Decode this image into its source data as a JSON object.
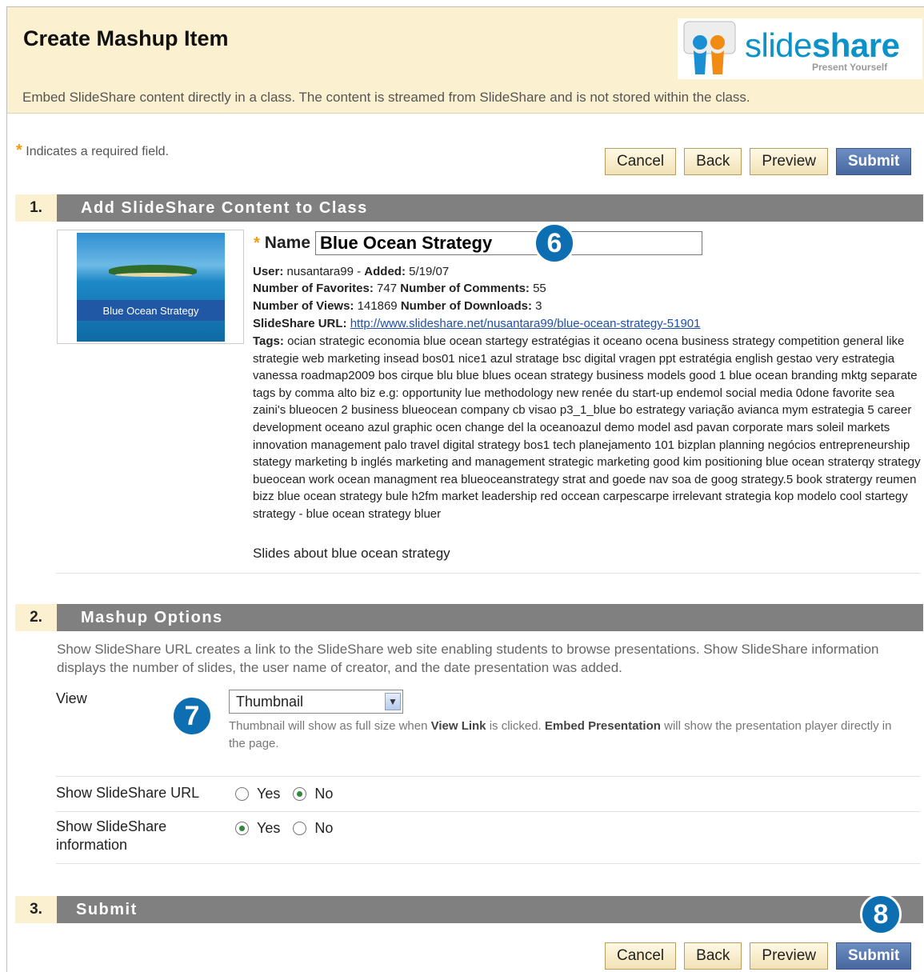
{
  "header": {
    "title": "Create Mashup Item",
    "description": "Embed SlideShare content directly in a class. The content is streamed from SlideShare and is not stored within the class.",
    "logo": {
      "word_light": "slide",
      "word_bold": "share",
      "tagline": "Present Yourself"
    }
  },
  "required_note": "Indicates a required field.",
  "buttons": {
    "cancel": "Cancel",
    "back": "Back",
    "preview": "Preview",
    "submit": "Submit"
  },
  "section1": {
    "number": "1.",
    "title": "Add SlideShare Content to Class",
    "thumbnail_label": "Blue Ocean Strategy",
    "name_label": "Name",
    "name_value": "Blue Ocean Strategy",
    "user_label": "User:",
    "user_value": "nusantara99",
    "added_label": "Added:",
    "added_value": "5/19/07",
    "favorites_label": "Number of Favorites:",
    "favorites_value": "747",
    "comments_label": "Number of Comments:",
    "comments_value": "55",
    "views_label": "Number of Views:",
    "views_value": "141869",
    "downloads_label": "Number of Downloads:",
    "downloads_value": "3",
    "url_label": "SlideShare URL:",
    "url_value": "http://www.slideshare.net/nusantara99/blue-ocean-strategy-51901",
    "tags_label": "Tags:",
    "tags_value": "ocian strategic economia blue ocean startegy estratégias it oceano ocena business strategy competition general like strategie web marketing insead bos01 nice1 azul stratage bsc digital vragen ppt estratégia english gestao very estrategia vanessa roadmap2009 bos cirque blu blue blues ocean strategy business models good 1 blue ocean branding mktg separate tags by comma alto biz e.g: opportunity lue methodology new renée du start-up endemol social media 0done favorite sea zaini's blueocen 2 business blueocean company cb visao p3_1_blue bo estrategy variação avianca mym estrategia 5 career development oceano azul graphic ocen change del la oceanoazul demo model asd pavan corporate mars soleil markets innovation management palo travel digital strategy bos1 tech planejamento 101 bizplan planning negócios entrepreneurship stategy marketing b inglés marketing and management strategic marketing good kim positioning blue ocean straterqy strategy bueocean work ocean managment rea blueoceanstrategy strat and goede nav soa de goog strategy.5 book stratergy reumen bizz blue ocean strategy bule h2fm market leadership red occean carpescarpe irrelevant strategia kop modelo cool startegy strategy - blue ocean strategy bluer",
    "slides_description": "Slides about blue ocean strategy"
  },
  "section2": {
    "number": "2.",
    "title": "Mashup Options",
    "description": "Show SlideShare URL creates a link to the SlideShare web site enabling students to browse presentations. Show SlideShare information displays the number of slides, the user name of creator, and the date presentation was added.",
    "view_label": "View",
    "view_selected": "Thumbnail",
    "view_help_1": "Thumbnail will show as full size when ",
    "view_help_b1": "View Link",
    "view_help_2": " is clicked. ",
    "view_help_b2": "Embed Presentation",
    "view_help_3": " will show the presentation player directly in the page.",
    "show_url_label": "Show SlideShare URL",
    "show_info_label": "Show SlideShare information",
    "yes": "Yes",
    "no": "No"
  },
  "section3": {
    "number": "3.",
    "title": "Submit"
  },
  "callouts": {
    "c6": "6",
    "c7": "7",
    "c8": "8"
  },
  "colors": {
    "header_bg": "#fbf0cf",
    "section_bar": "#808080",
    "submit_button": "#47689f",
    "callout": "#0d6eb2",
    "required_star": "#f39c12"
  }
}
